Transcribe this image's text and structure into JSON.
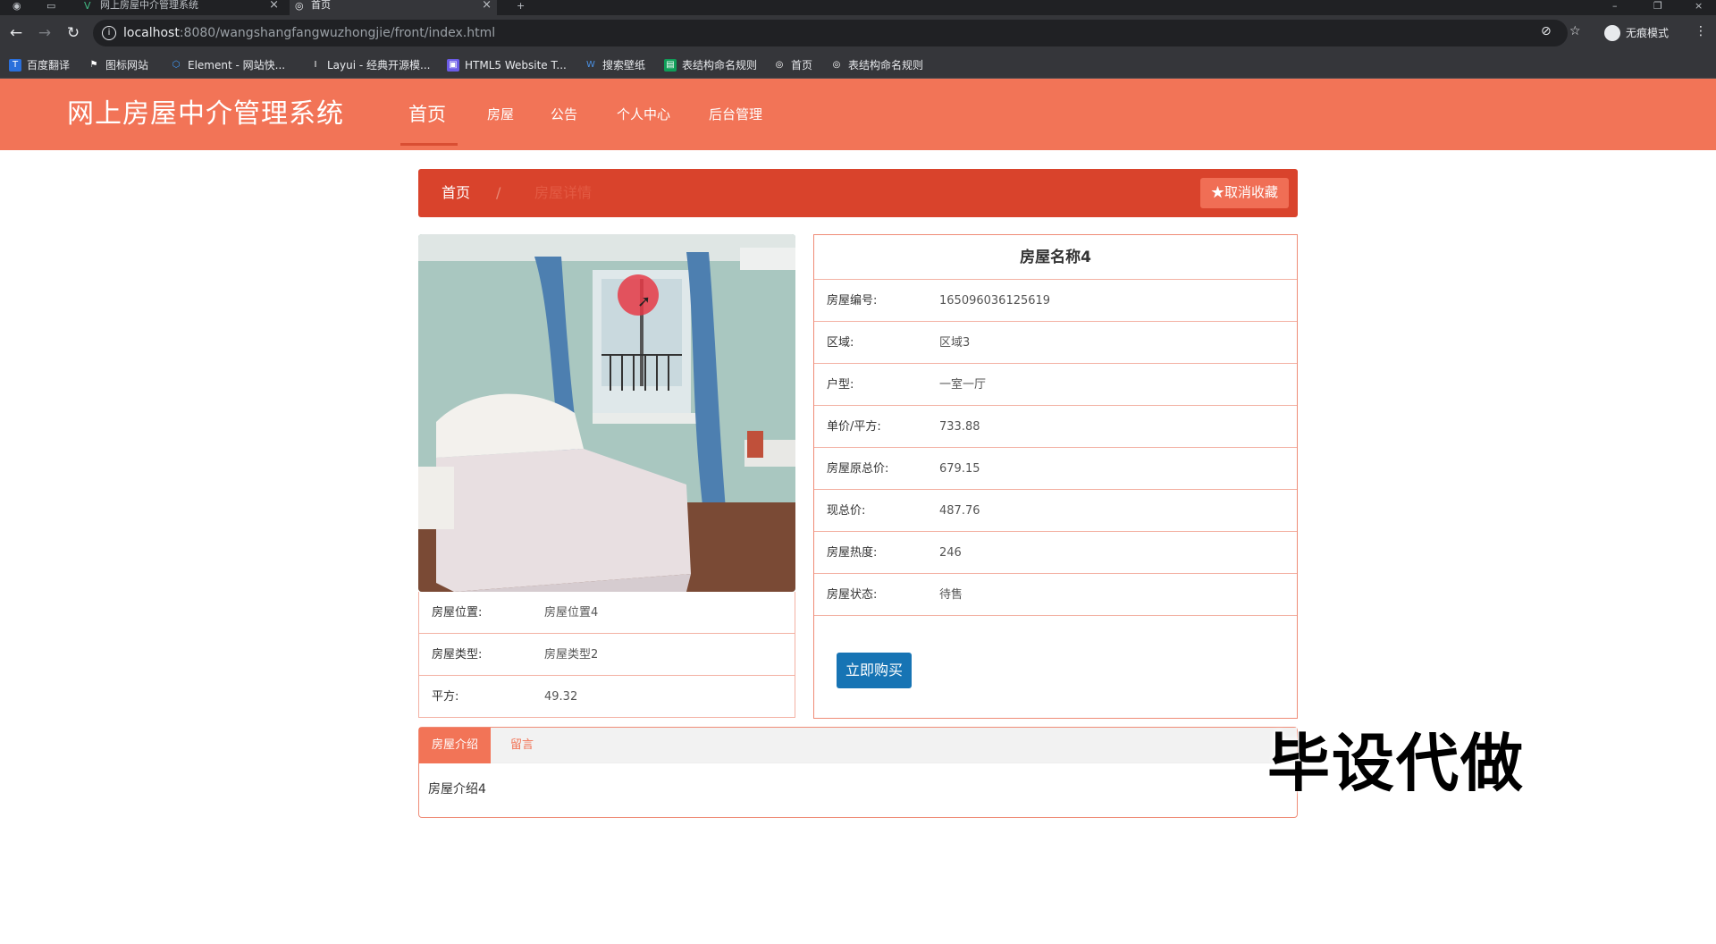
{
  "browser": {
    "tabs": [
      {
        "title": "网上房屋中介管理系统",
        "active": false
      },
      {
        "title": "首页",
        "active": true
      }
    ],
    "url_host": "localhost",
    "url_path": ":8080/wangshangfangwuzhongjie/front/index.html",
    "profile_label": "无痕模式",
    "bookmarks": [
      "百度翻译",
      "图标网站",
      "Element - 网站快...",
      "Layui - 经典开源模...",
      "HTML5 Website T...",
      "搜索壁纸",
      "表结构命名规则",
      "首页",
      "表结构命名规则"
    ]
  },
  "header": {
    "brand": "网上房屋中介管理系统",
    "nav": [
      "首页",
      "房屋",
      "公告",
      "个人中心",
      "后台管理"
    ],
    "active_nav": "首页",
    "bg_color": "#f27457"
  },
  "breadcrumb": {
    "home": "首页",
    "separator": "/",
    "current": "房屋详情",
    "favorite_button": "取消收藏"
  },
  "house": {
    "title": "房屋名称4",
    "left_rows": [
      {
        "label": "房屋位置:",
        "value": "房屋位置4"
      },
      {
        "label": "房屋类型:",
        "value": "房屋类型2"
      },
      {
        "label": "平方:",
        "value": "49.32"
      }
    ],
    "right_rows": [
      {
        "label": "房屋编号:",
        "value": "165096036125619"
      },
      {
        "label": "区域:",
        "value": "区域3"
      },
      {
        "label": "户型:",
        "value": "一室一厅"
      },
      {
        "label": "单价/平方:",
        "value": "733.88"
      },
      {
        "label": "房屋原总价:",
        "value": "679.15"
      },
      {
        "label": "现总价:",
        "value": "487.76"
      },
      {
        "label": "房屋热度:",
        "value": "246"
      },
      {
        "label": "房屋状态:",
        "value": "待售"
      }
    ],
    "buy_button": "立即购买"
  },
  "tabs": {
    "items": [
      "房屋介绍",
      "留言"
    ],
    "active": "房屋介绍",
    "content": "房屋介绍4"
  },
  "watermark": "毕设代做"
}
